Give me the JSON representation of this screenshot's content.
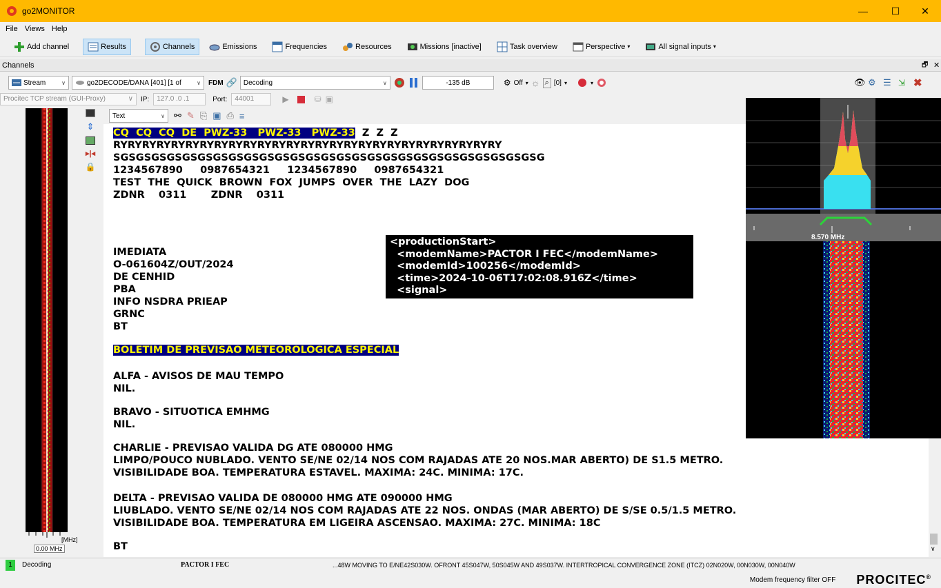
{
  "window": {
    "title": "go2MONITOR",
    "minimize": "—",
    "maximize": "☐",
    "close": "✕"
  },
  "menu": [
    "File",
    "Views",
    "Help"
  ],
  "toolbar": {
    "add_channel": "Add channel",
    "results": "Results",
    "channels": "Channels",
    "emissions": "Emissions",
    "frequencies": "Frequencies",
    "resources": "Resources",
    "missions": "Missions [inactive]",
    "task_overview": "Task overview",
    "perspective": "Perspective",
    "all_signal_inputs": "All signal inputs"
  },
  "panel": {
    "title": "Channels"
  },
  "channel_toolbar": {
    "stream": "Stream",
    "decoder": "go2DECODE/DANA [401] [1 of",
    "fdm": "FDM",
    "mode": "Decoding",
    "level": "-135 dB",
    "off": "Off",
    "count": "[0]"
  },
  "input_row": {
    "source": "Procitec TCP stream (GUI-Proxy)",
    "ip_label": "IP:",
    "ip": "127.0 .0 .1",
    "port_label": "Port:",
    "port": "44001"
  },
  "text_toolbar": {
    "format": "Text"
  },
  "waterfall": {
    "unit": "[MHz]",
    "freq": "0.00 MHz"
  },
  "spectrum": {
    "freq_label": "8.570 MHz"
  },
  "document": {
    "l1a": "CQ  CQ  CQ  DE  PWZ-33   PWZ-33   PWZ-33",
    "l1b": "  Z  Z  Z",
    "l2": "RYRYRYRYRYRYRYRYRYRYRYRYRYRYRYRYRYRYRYRYRYRYRYRYRYRYRY",
    "l3": "SGSGSGSGSGSGSGSGSGSGSGSGSGSGSGSGSGSGSGSGSGSGSGSGSGSGSGSG",
    "l4": "1234567890     0987654321     1234567890     0987654321",
    "l5": "TEST  THE  QUICK  BROWN  FOX  JUMPS  OVER  THE  LAZY  DOG",
    "l6": "ZDNR    0311       ZDNR    0311",
    "l7": "IMEDIATA",
    "l8": "O-061604Z/OUT/2024",
    "l9": "DE CENHID",
    "l10": "PBA",
    "l11": "INFO NSDRA PRIEAP",
    "l12": "GRNC",
    "l13": "BT",
    "l14": "BOLETIM DE PREVISAO METEOROLOGICA ESPECIAL",
    "l15": "ALFA - AVISOS DE MAU TEMPO",
    "l16": "NIL.",
    "l17": "BRAVO - SITUOTICA EMHMG",
    "l18": "NIL.",
    "l19": "CHARLIE - PREVISAO VALIDA DG ATE 080000 HMG",
    "l20": "LIMPO/POUCO NUBLADO. VENTO SE/NE 02/14 NOS COM RAJADAS ATE 20 NOS.MAR ABERTO) DE S1.5 METRO.",
    "l21": "VISIBILIDADE BOA. TEMPERATURA ESTAVEL. MAXIMA: 24C. MINIMA: 17C.",
    "l22": "DELTA - PREVISAO VALIDA DE 080000 HMG ATE 090000 HMG",
    "l23": "LIUBLADO. VENTO SE/NE 02/14 NOS COM RAJADAS ATE 22 NOS. ONDAS (MAR ABERTO) DE S/SE 0.5/1.5 METRO.",
    "l24": "VISIBILIDADE BOA. TEMPERATURA EM LIGEIRA ASCENSAO. MAXIMA: 27C. MINIMA: 18C",
    "l25": "BT"
  },
  "xml": {
    "x1": "<productionStart>",
    "x2": "  <modemName>PACTOR I FEC</modemName>",
    "x3": "  <modemId>100256</modemId>",
    "x4": "  <time>2024-10-06T17:02:08.916Z</time>",
    "x5": "  <signal>"
  },
  "status": {
    "num": "1",
    "state": "Decoding",
    "modem": "PACTOR I FEC",
    "ticker": "...48W  MOVING TO E/NE42S030W. OFRONT  45S047W, 50S045W AND 49S037W. INTERTROPICAL CONVERGENCE ZONE (ITCZ)  02N020W, 00N030W, 00N040W",
    "filter": "Modem frequency filter OFF",
    "brand": "PROCITEC",
    "reg": "®"
  },
  "colors": {
    "titlebar": "#ffb900",
    "highlight_bg": "#000080",
    "highlight_fg": "#fff700"
  }
}
